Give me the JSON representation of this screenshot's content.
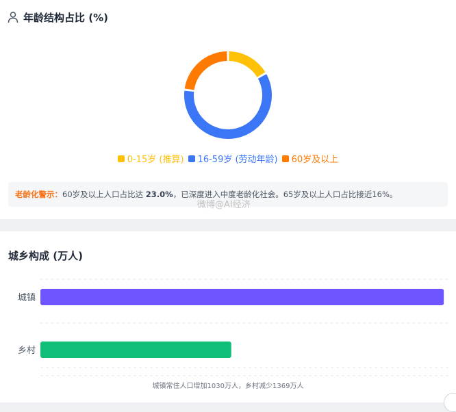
{
  "age_section": {
    "title": "年龄结构占比 (%)",
    "warning": {
      "label": "老龄化警示：",
      "text_before": "60岁及以上人口占比达 ",
      "value": "23.0%",
      "text_after": "，已深度进入中度老龄化社会。65岁及以上人口占比接近16%。"
    }
  },
  "urban_section": {
    "title": "城乡构成 (万人)",
    "footnote": "城镇常住人口增加1030万人，乡村减少1369万人"
  },
  "watermark": "微博@AI经济",
  "chart_data": [
    {
      "type": "pie",
      "title": "年龄结构占比 (%)",
      "categories": [
        "0-15岁 (推算)",
        "16-59岁 (劳动年龄)",
        "60岁及以上"
      ],
      "values": [
        16.6,
        60.4,
        23.0
      ],
      "colors": [
        "#ffc107",
        "#3b76f6",
        "#ff7a00"
      ],
      "legend_position": "bottom"
    },
    {
      "type": "bar",
      "orientation": "horizontal",
      "title": "城乡构成 (万人)",
      "categories": [
        "城镇",
        "乡村"
      ],
      "values": [
        94900,
        44900
      ],
      "xlim": [
        0,
        96000
      ],
      "colors": [
        "#6d55ff",
        "#0fbf78"
      ],
      "grid": true
    }
  ]
}
